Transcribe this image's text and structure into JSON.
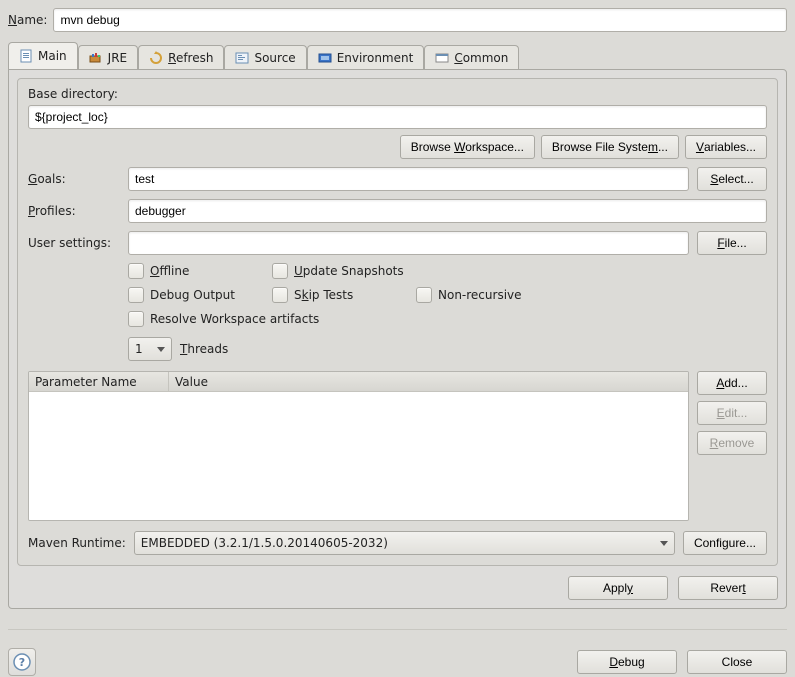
{
  "name": {
    "label": "Name:",
    "value": "mvn debug"
  },
  "tabs": [
    {
      "label": "Main",
      "icon": "file-icon"
    },
    {
      "label": "JRE",
      "icon": "jre-icon"
    },
    {
      "label": "Refresh",
      "icon": "refresh-icon"
    },
    {
      "label": "Source",
      "icon": "source-icon"
    },
    {
      "label": "Environment",
      "icon": "environment-icon"
    },
    {
      "label": "Common",
      "icon": "common-icon"
    }
  ],
  "basedir": {
    "label": "Base directory:",
    "value": "${project_loc}",
    "browse_ws": "Browse Workspace...",
    "browse_fs": "Browse File System...",
    "vars": "Variables..."
  },
  "goals": {
    "label": "Goals:",
    "value": "test",
    "select": "Select..."
  },
  "profiles": {
    "label": "Profiles:",
    "value": "debugger"
  },
  "usersettings": {
    "label": "User settings:",
    "value": "",
    "file": "File..."
  },
  "checks": {
    "offline": "Offline",
    "update": "Update Snapshots",
    "debugout": "Debug Output",
    "skip": "Skip Tests",
    "nonrec": "Non-recursive",
    "resolve": "Resolve Workspace artifacts"
  },
  "threads": {
    "value": "1",
    "label": "Threads"
  },
  "params": {
    "col1": "Parameter Name",
    "col2": "Value",
    "add": "Add...",
    "edit": "Edit...",
    "remove": "Remove"
  },
  "runtime": {
    "label": "Maven Runtime:",
    "value": "EMBEDDED (3.2.1/1.5.0.20140605-2032)",
    "configure": "Configure..."
  },
  "actions": {
    "apply": "Apply",
    "revert": "Revert",
    "debug": "Debug",
    "close": "Close"
  }
}
